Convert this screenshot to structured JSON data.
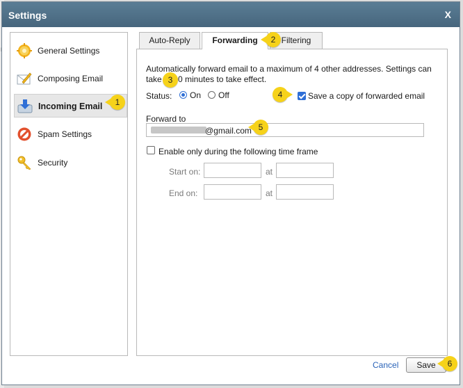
{
  "dialog": {
    "title": "Settings",
    "close_label": "X"
  },
  "sidebar": {
    "items": [
      {
        "label": "General Settings",
        "icon": "gear-icon",
        "active": false
      },
      {
        "label": "Composing Email",
        "icon": "compose-icon",
        "active": false
      },
      {
        "label": "Incoming Email",
        "icon": "inbox-download-icon",
        "active": true
      },
      {
        "label": "Spam Settings",
        "icon": "spam-block-icon",
        "active": false
      },
      {
        "label": "Security",
        "icon": "key-icon",
        "active": false
      }
    ]
  },
  "tabs": [
    {
      "label": "Auto-Reply",
      "active": false
    },
    {
      "label": "Forwarding",
      "active": true
    },
    {
      "label": "Filtering",
      "active": false
    }
  ],
  "forwarding": {
    "info_line1": "Automatically forward email to a maximum of 4 other addresses. Settings can",
    "info_line2_a": "take",
    "info_line2_b": "0 minutes to take effect.",
    "status_label": "Status:",
    "status_on_label": "On",
    "status_off_label": "Off",
    "status_value": "On",
    "save_copy_label": "Save a copy of forwarded email",
    "save_copy_checked": true,
    "forward_to_label": "Forward to",
    "forward_to_value": "@gmail.com",
    "time_frame_label": "Enable only during the following time frame",
    "time_frame_checked": false,
    "start_on_label": "Start on:",
    "end_on_label": "End on:",
    "at_label": "at"
  },
  "footer": {
    "cancel_label": "Cancel",
    "save_label": "Save"
  },
  "callouts": [
    "1",
    "2",
    "3",
    "4",
    "5",
    "6"
  ],
  "colors": {
    "titlebar": "#4f7189",
    "accent_blue": "#2f6fd6",
    "callout": "#f6d21a",
    "link": "#2a63b8"
  }
}
